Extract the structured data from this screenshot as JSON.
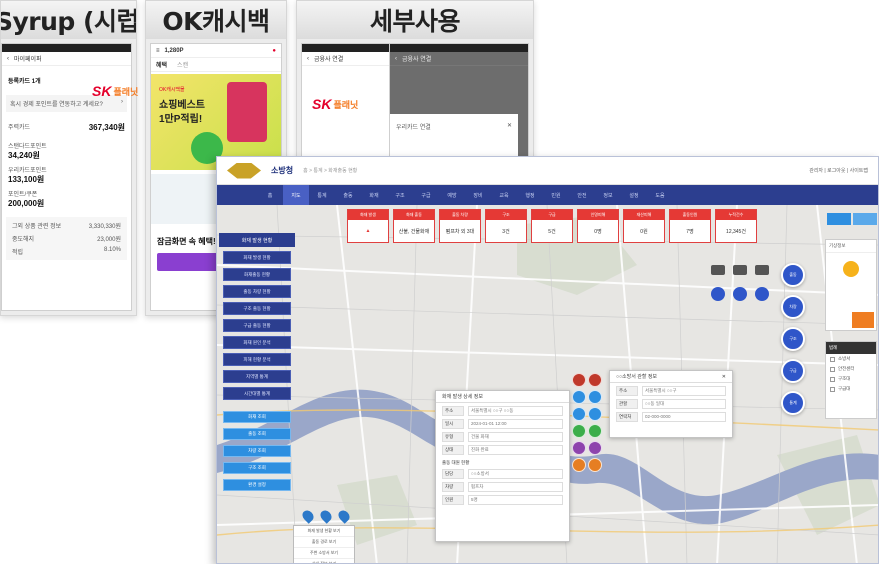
{
  "panels": [
    {
      "title": "Syrup (시럽)"
    },
    {
      "title": "OK캐시백"
    },
    {
      "title": "세부사용"
    }
  ],
  "syrup": {
    "nav_title": "마이페이퍼",
    "section": "등록카드 1개",
    "notice": "혹시 경제 포인트를 연동하고 계세요?",
    "card_label": "주력카드",
    "card_amount": "367,340원",
    "rows": [
      {
        "label": "스탠다드포인트",
        "value": "34,240원"
      },
      {
        "label": "우리카드포인트",
        "value": "133,100원"
      },
      {
        "label": "포인트/쿠폰",
        "value": "200,000원"
      }
    ],
    "footer_rows": [
      {
        "label": "그외 상품 관련 정보",
        "value": "3,330,330원"
      },
      {
        "label": "중도해지",
        "value": "23,000원"
      },
      {
        "label": "적립",
        "value": "8.10%"
      }
    ]
  },
  "okcash": {
    "points": "1,280P",
    "tab1": "혜택",
    "tab2": "스캔",
    "banner_sub": "OK캐시백몰",
    "banner_title": "쇼핑베스트",
    "banner_title2": "1만P적립!",
    "section": "잠금화면 속 혜택!"
  },
  "detail": {
    "nav_title": "금융사 연결",
    "popup_title": "우리카드 연결"
  },
  "sk_logo": {
    "sk": "SK",
    "play": "플래닛"
  },
  "app": {
    "title": "소방청",
    "crumb": "홈 > 통계 > 화재출동 현황",
    "user": "관리자 | 로그아웃 | 사이트맵",
    "nav": [
      "홈",
      "지도",
      "통계",
      "출동",
      "화재",
      "구조",
      "구급",
      "예방",
      "장비",
      "교육",
      "행정",
      "민원",
      "안전",
      "정보",
      "설정",
      "도움"
    ],
    "nav_active_index": 1,
    "sidebar_title": "화재 발생 현황",
    "sidebar_items": [
      "화재 발생 현황",
      "화재출동 현황",
      "출동 차량 현황",
      "구조 출동 현황",
      "구급 출동 현황",
      "화재 원인 분석",
      "피해 현황 분석",
      "지역별 통계",
      "시간대별 통계"
    ],
    "sidebar_items2": [
      "화재 조회",
      "출동 조회",
      "차량 조회",
      "구조 조회",
      "환경 설정"
    ],
    "stats": [
      {
        "label": "화재 발생",
        "value": "▲"
      },
      {
        "label": "화재 출동",
        "value": "산불, 건물화재"
      },
      {
        "label": "출동 차량",
        "value": "펌프차 외 3대"
      },
      {
        "label": "구조",
        "value": "3건"
      },
      {
        "label": "구급",
        "value": "5건"
      },
      {
        "label": "인명피해",
        "value": "0명"
      },
      {
        "label": "재산피해",
        "value": "0원"
      },
      {
        "label": "출동인원",
        "value": "7명"
      },
      {
        "label": "누적건수",
        "value": "12,345건"
      }
    ],
    "popup_main": {
      "title": "화재 발생 상세 정보",
      "rows": [
        {
          "key": "주소",
          "value": "서울특별시 ○○구 ○○동"
        },
        {
          "key": "일시",
          "value": "2024-01-01 12:00"
        },
        {
          "key": "유형",
          "value": "건물 화재"
        },
        {
          "key": "상태",
          "value": "진화 완료"
        }
      ],
      "section": "출동 대원 현황",
      "rows2": [
        {
          "key": "담당",
          "value": "○○소방서"
        },
        {
          "key": "차량",
          "value": "펌프차"
        },
        {
          "key": "인원",
          "value": "5명"
        }
      ]
    },
    "popup_small": {
      "title": "○○소방서 관할 정보",
      "rows": [
        {
          "key": "주소",
          "value": "서울특별시 ○○구"
        },
        {
          "key": "관할",
          "value": "○○동 일대"
        },
        {
          "key": "연락처",
          "value": "02-000-0000"
        }
      ]
    },
    "context_menu": [
      "화재 발생 현황 보기",
      "출동 경로 보기",
      "주변 소방서 보기",
      "상세 정보 보기"
    ],
    "fab_labels": [
      "출동",
      "차량",
      "구조",
      "구급",
      "통계"
    ],
    "right_panel_title": "기상정보",
    "right_legend_title": "범례",
    "right_legend_items": [
      "소방서",
      "안전센터",
      "구조대",
      "구급대"
    ]
  },
  "colors": {
    "nav": "#2c3e8f",
    "accent_red": "#e53935",
    "fab_blue": "#2f56c9",
    "river": "#9aa7c9"
  }
}
